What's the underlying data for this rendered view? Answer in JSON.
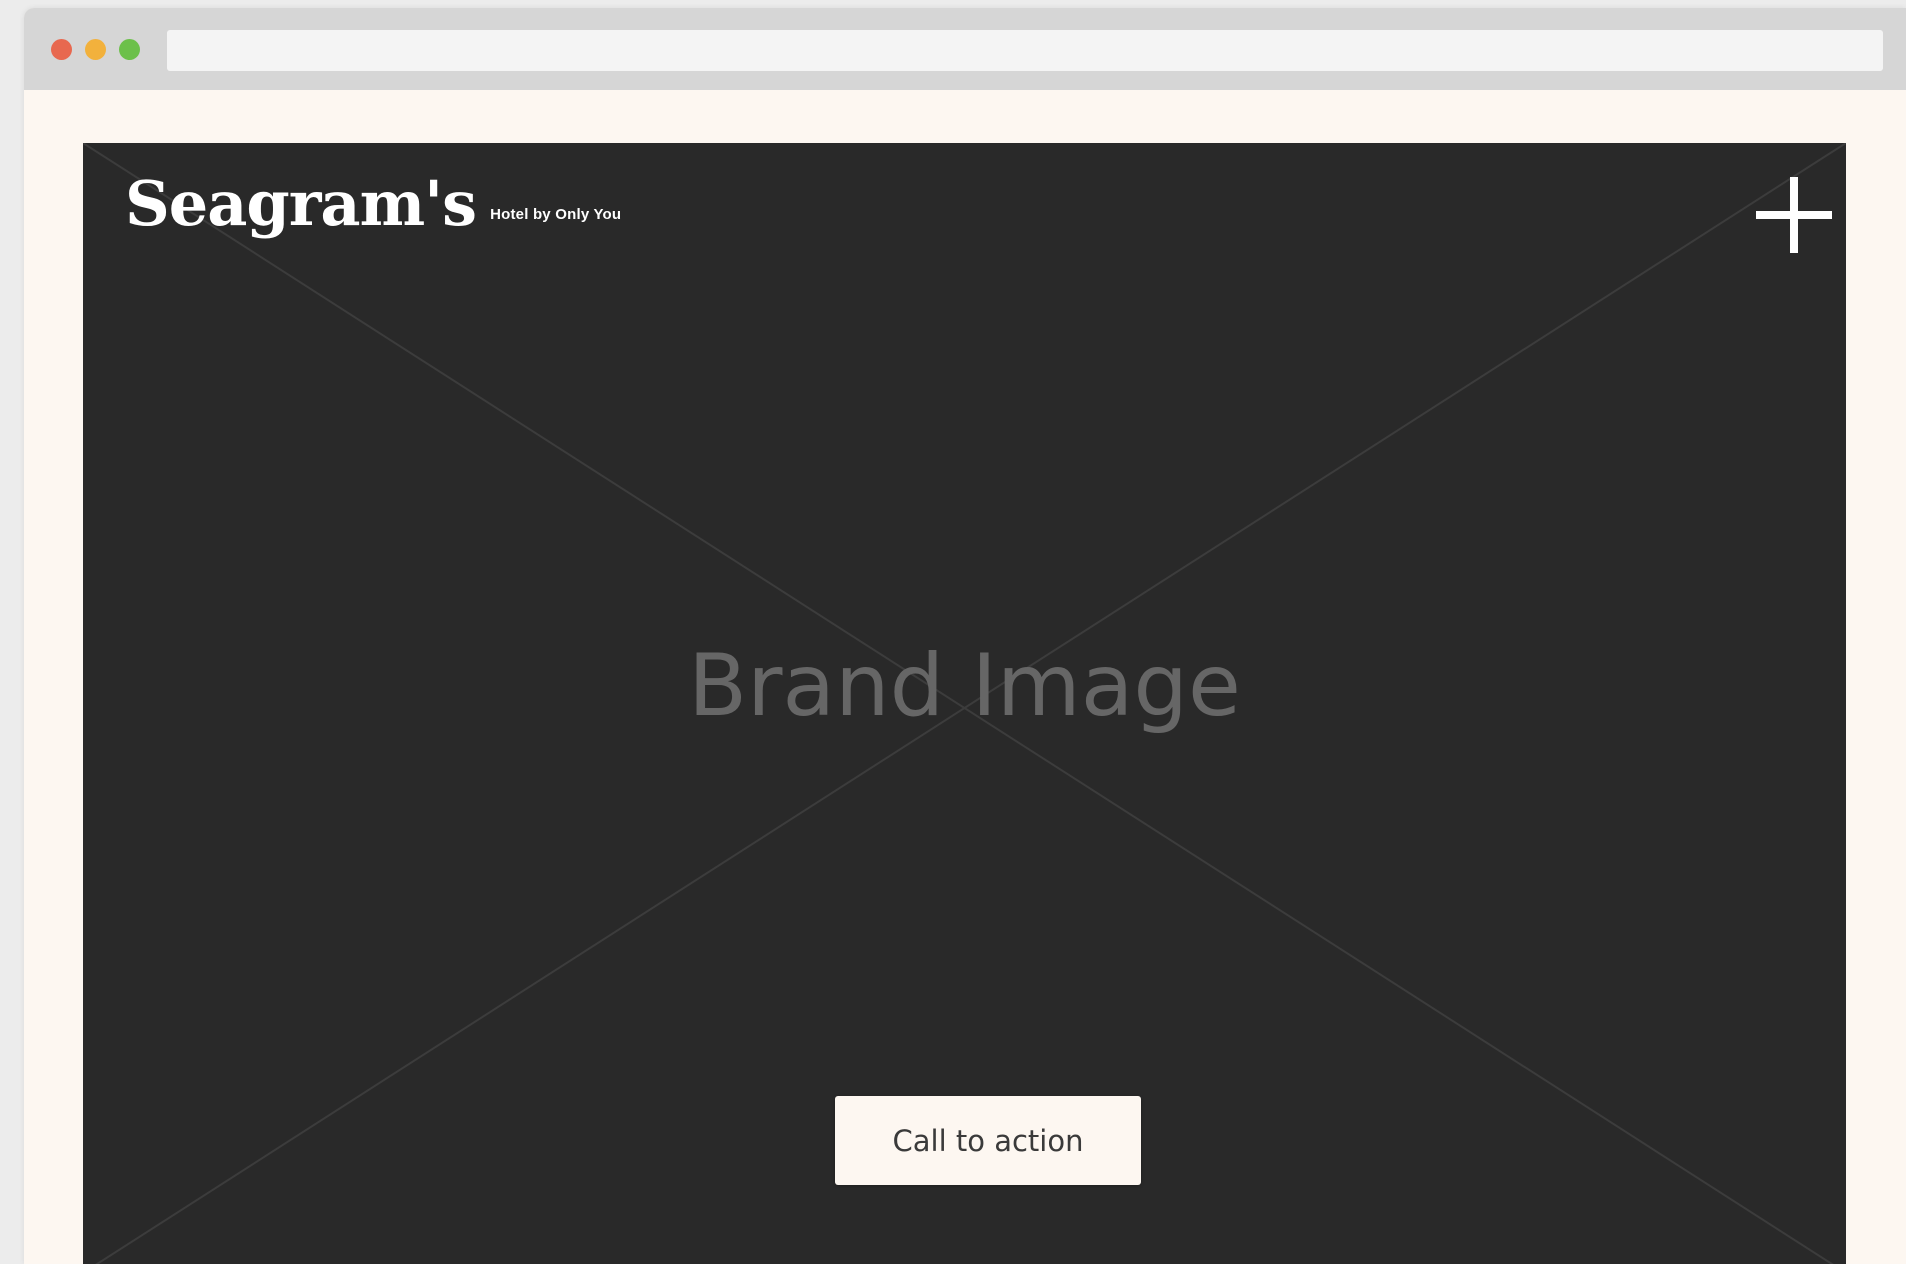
{
  "browser": {
    "traffic_lights": {
      "close_color": "#e8684f",
      "minimize_color": "#f2b13c",
      "maximize_color": "#6cc04a"
    },
    "address_bar": {
      "value": "",
      "placeholder": ""
    }
  },
  "header": {
    "logo_wordmark": "Seagram's",
    "logo_tagline": "Hotel by Only You",
    "menu_icon": "plus-icon"
  },
  "hero": {
    "placeholder_label": "Brand Image",
    "background_color": "#292929",
    "cta_label": "Call to action"
  },
  "colors": {
    "page_background": "#fdf7f1",
    "title_bar": "#d6d6d6",
    "hero_background": "#292929"
  }
}
